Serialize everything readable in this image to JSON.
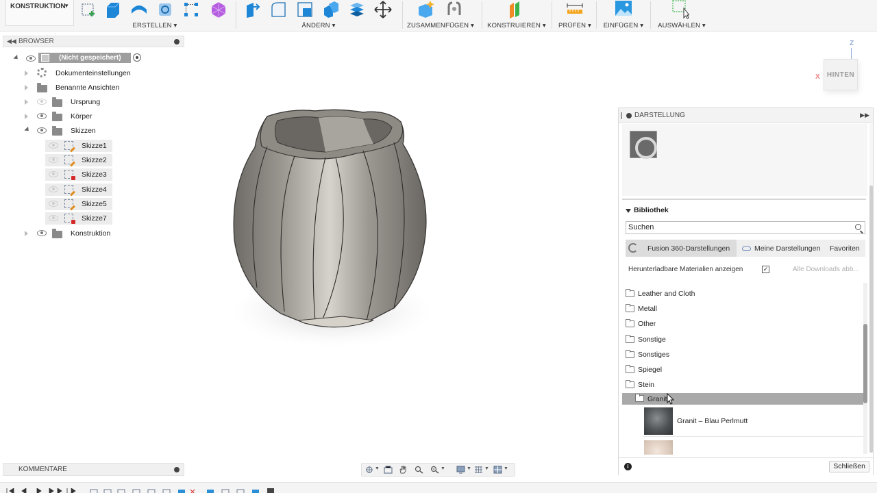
{
  "toolbar": {
    "workspace": "KONSTRUKTION",
    "groups": {
      "erstellen": "ERSTELLEN",
      "aendern": "ÄNDERN",
      "zusammenfuegen": "ZUSAMMENFÜGEN",
      "konstruieren": "KONSTRUIEREN",
      "pruefen": "PRÜFEN",
      "einfuegen": "EINFÜGEN",
      "auswaehlen": "AUSWÄHLEN"
    }
  },
  "browser": {
    "title": "BROWSER",
    "root": "(Nicht gespeichert)",
    "items": {
      "dokumenteinstellungen": "Dokumenteinstellungen",
      "benannte_ansichten": "Benannte Ansichten",
      "ursprung": "Ursprung",
      "koerper": "Körper",
      "skizzen": "Skizzen",
      "konstruktion": "Konstruktion"
    },
    "sketches": [
      "Skizze1",
      "Skizze2",
      "Skizze3",
      "Skizze4",
      "Skizze5",
      "Skizze7"
    ]
  },
  "comments": {
    "title": "KOMMENTARE"
  },
  "viewcube": {
    "face": "HINTEN",
    "z": "Z",
    "x": "X"
  },
  "appearance": {
    "title": "DARSTELLUNG",
    "library_title": "Bibliothek",
    "search_placeholder": "Suchen",
    "tabs": {
      "fusion": "Fusion 360-Darstellungen",
      "mine": "Meine Darstellungen",
      "favorites": "Favoriten"
    },
    "downloadable_label": "Herunterladbare Materialien anzeigen",
    "downloadable_checked": true,
    "download_all": "Alle Downloads abb...",
    "folders": [
      "Leather and Cloth",
      "Metall",
      "Other",
      "Sonstige",
      "Sonstiges",
      "Spiegel",
      "Stein"
    ],
    "subfolder": "Granit",
    "materials": [
      "Granit – Blau Perlmutt"
    ],
    "close_label": "Schließen",
    "info_icon": "i"
  },
  "colors": {
    "accent_blue": "#2a8fd6",
    "selection_gray": "#a9a9a9",
    "model_gray": "#8c8882"
  }
}
